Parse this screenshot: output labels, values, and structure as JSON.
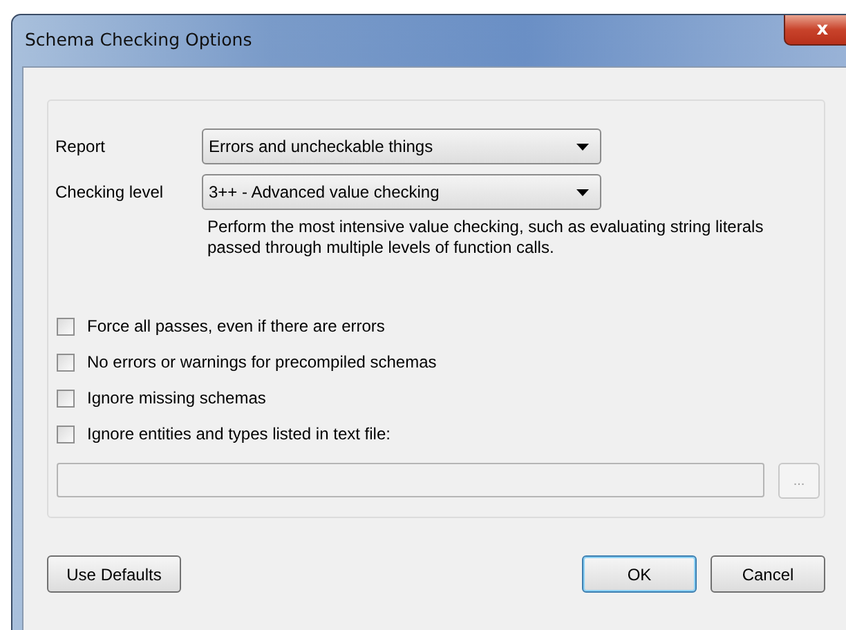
{
  "window": {
    "title": "Schema Checking Options",
    "close_icon": "x"
  },
  "fields": [
    {
      "label": "Report",
      "value": "Errors and uncheckable things"
    },
    {
      "label": "Checking level",
      "value": "3++ - Advanced value checking",
      "description": "Perform the most intensive value checking, such as evaluating string literals passed through multiple levels of function calls."
    }
  ],
  "checkboxes": [
    {
      "label": "Force all passes, even if there are errors",
      "checked": false
    },
    {
      "label": "No errors or warnings for precompiled schemas",
      "checked": false
    },
    {
      "label": "Ignore missing schemas",
      "checked": false
    },
    {
      "label": "Ignore entities and types listed in text file:",
      "checked": false
    }
  ],
  "file_field": {
    "disabled": true,
    "browse_label": "..."
  },
  "buttons": [
    {
      "label": "Use Defaults",
      "default": false
    },
    {
      "label": "OK",
      "default": true
    },
    {
      "label": "Cancel",
      "default": false
    }
  ]
}
